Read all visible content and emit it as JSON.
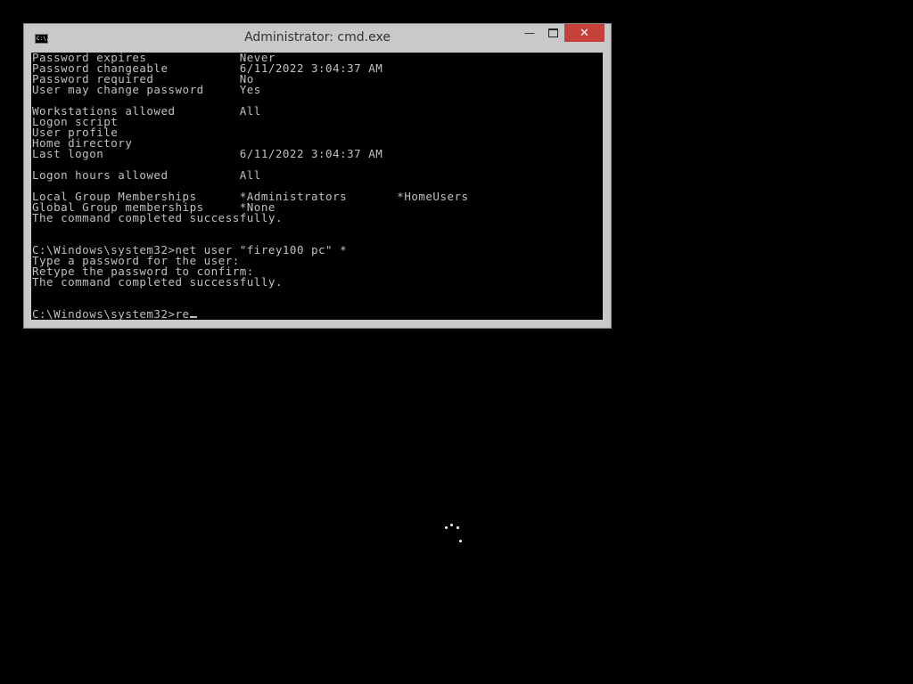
{
  "window": {
    "title": "Administrator: cmd.exe",
    "icon": "cmd-icon",
    "icon_text": "C:\\.",
    "controls": {
      "minimize": "—",
      "close": "✕"
    }
  },
  "console": {
    "lines": [
      "Password expires             Never",
      "Password changeable          6/11/2022 3:04:37 AM",
      "Password required            No",
      "User may change password     Yes",
      "",
      "Workstations allowed         All",
      "Logon script",
      "User profile",
      "Home directory",
      "Last logon                   6/11/2022 3:04:37 AM",
      "",
      "Logon hours allowed          All",
      "",
      "Local Group Memberships      *Administrators       *HomeUsers",
      "Global Group memberships     *None",
      "The command completed successfully.",
      "",
      "",
      "C:\\Windows\\system32>net user \"firey100 pc\" *",
      "Type a password for the user:",
      "Retype the password to confirm:",
      "The command completed successfully.",
      "",
      ""
    ],
    "prompt": "C:\\Windows\\system32>re"
  },
  "colors": {
    "desktop": "#000000",
    "window_frame": "#c9c9c9",
    "close_button": "#c7403a",
    "console_text": "#c0c0c0"
  }
}
